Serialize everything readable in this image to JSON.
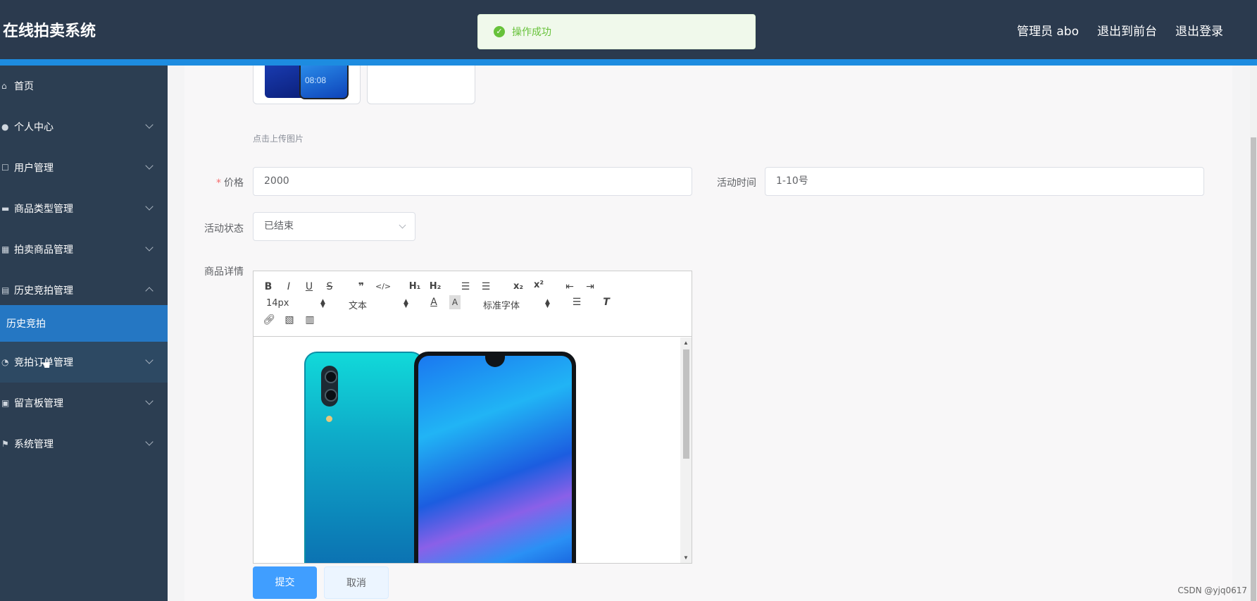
{
  "header": {
    "app_title": "在线拍卖系统",
    "user_label": "管理员 abo",
    "front_link": "退出到前台",
    "logout_link": "退出登录"
  },
  "toast": {
    "message": "操作成功",
    "type": "success",
    "icon": "check-circle-icon"
  },
  "sidebar": {
    "items": [
      {
        "label": "首页",
        "icon": "home-icon",
        "expandable": false
      },
      {
        "label": "个人中心",
        "icon": "user-icon",
        "expandable": true
      },
      {
        "label": "用户管理",
        "icon": "edit-icon",
        "expandable": true
      },
      {
        "label": "商品类型管理",
        "icon": "briefcase-icon",
        "expandable": true
      },
      {
        "label": "拍卖商品管理",
        "icon": "grid-icon",
        "expandable": true
      },
      {
        "label": "历史竞拍管理",
        "icon": "document-icon",
        "expandable": true,
        "expanded": true
      },
      {
        "label": "竞拍订单管理",
        "icon": "clock-icon",
        "expandable": true
      },
      {
        "label": "留言板管理",
        "icon": "clipboard-icon",
        "expandable": true
      },
      {
        "label": "系统管理",
        "icon": "flag-icon",
        "expandable": true
      }
    ],
    "active_subitem": "历史竞拍"
  },
  "form": {
    "thumb_time": "08:08",
    "upload_hint": "点击上传图片",
    "price_label": "价格",
    "price_value": "2000",
    "activity_time_label": "活动时间",
    "activity_time_value": "1-10号",
    "activity_status_label": "活动状态",
    "activity_status_value": "已结束",
    "details_label": "商品详情"
  },
  "editor": {
    "font_size": "14px",
    "block_format": "文本",
    "font_family": "标准字体"
  },
  "buttons": {
    "submit": "提交",
    "cancel": "取消"
  },
  "watermark": "CSDN @yjq0617",
  "colors": {
    "header_bg": "#2b3a4e",
    "accent": "#1d8ce0",
    "sidebar_bg": "#2c3e52",
    "active_item": "#2577c3",
    "primary_button": "#409eff"
  }
}
